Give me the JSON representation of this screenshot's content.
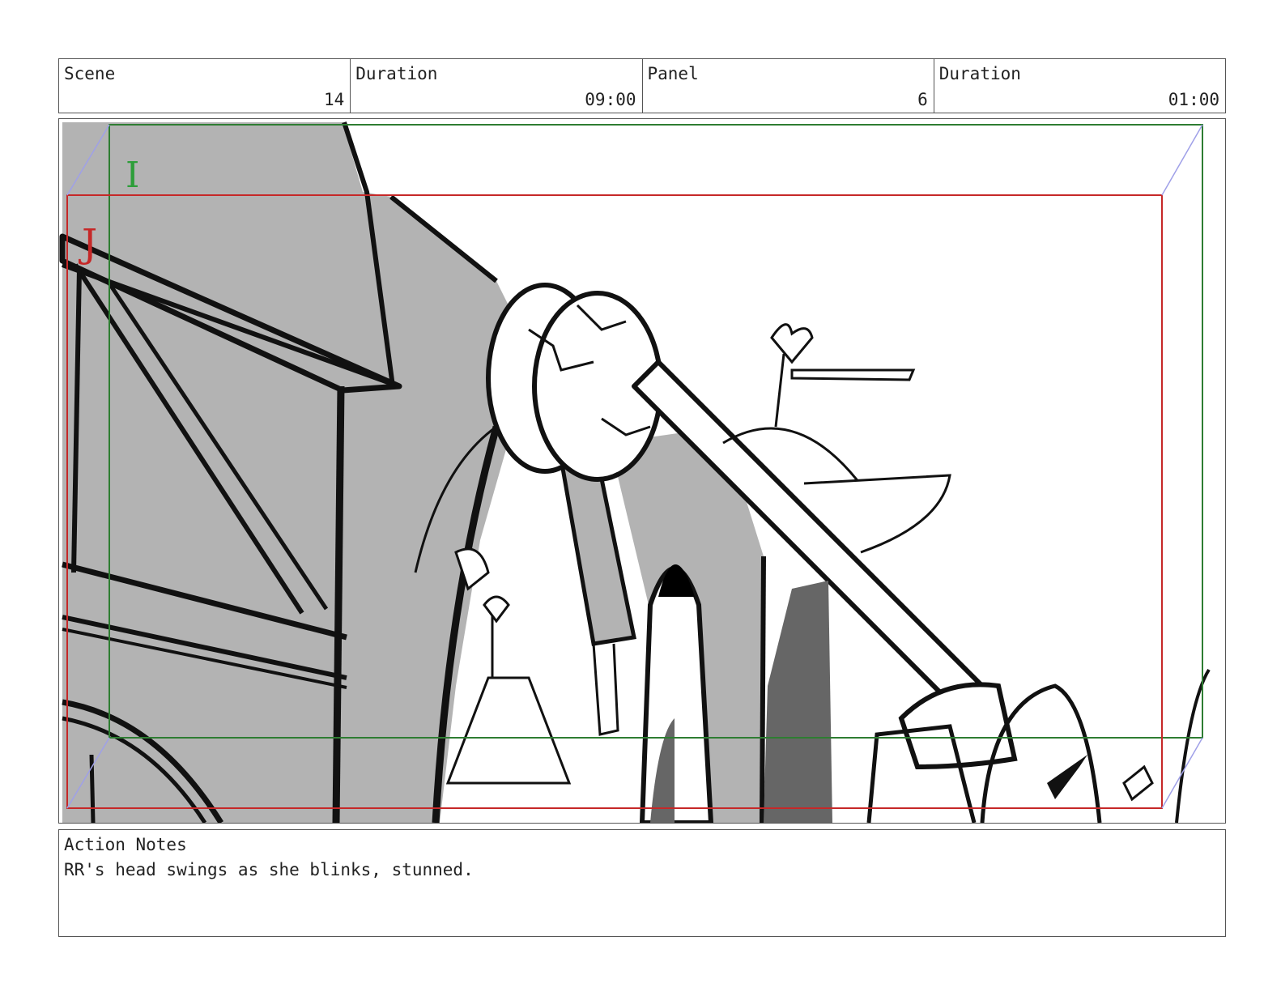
{
  "header": {
    "scene_label": "Scene",
    "scene_value": "14",
    "duration_label": "Duration",
    "duration_value": "09:00",
    "panel_label": "Panel",
    "panel_value": "6",
    "panel_duration_label": "Duration",
    "panel_duration_value": "01:00"
  },
  "panel": {
    "safe_marker_green": "I",
    "safe_marker_red": "J",
    "green_frame_color": "#2e7d32",
    "red_frame_color": "#c62828"
  },
  "notes": {
    "title": "Action Notes",
    "text": "RR's head swings as she blinks, stunned."
  }
}
